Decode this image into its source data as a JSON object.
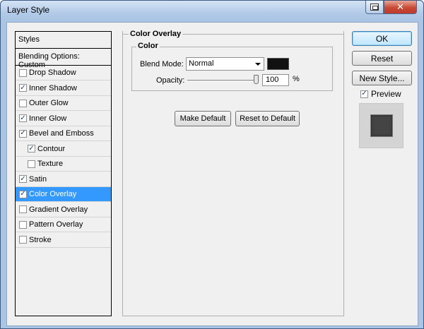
{
  "window": {
    "title": "Layer Style"
  },
  "styles_panel": {
    "header": "Styles",
    "blending_options": "Blending Options: Custom",
    "items": [
      {
        "label": "Drop Shadow",
        "checked": false,
        "indent": false,
        "selected": false
      },
      {
        "label": "Inner Shadow",
        "checked": true,
        "indent": false,
        "selected": false
      },
      {
        "label": "Outer Glow",
        "checked": false,
        "indent": false,
        "selected": false
      },
      {
        "label": "Inner Glow",
        "checked": true,
        "indent": false,
        "selected": false
      },
      {
        "label": "Bevel and Emboss",
        "checked": true,
        "indent": false,
        "selected": false
      },
      {
        "label": "Contour",
        "checked": true,
        "indent": true,
        "selected": false
      },
      {
        "label": "Texture",
        "checked": false,
        "indent": true,
        "selected": false
      },
      {
        "label": "Satin",
        "checked": true,
        "indent": false,
        "selected": false
      },
      {
        "label": "Color Overlay",
        "checked": true,
        "indent": false,
        "selected": true
      },
      {
        "label": "Gradient Overlay",
        "checked": false,
        "indent": false,
        "selected": false
      },
      {
        "label": "Pattern Overlay",
        "checked": false,
        "indent": false,
        "selected": false
      },
      {
        "label": "Stroke",
        "checked": false,
        "indent": false,
        "selected": false
      }
    ]
  },
  "overlay": {
    "title": "Color Overlay",
    "group_title": "Color",
    "blend_mode_label": "Blend Mode:",
    "blend_mode_value": "Normal",
    "swatch_color": "#111111",
    "opacity_label": "Opacity:",
    "opacity_value": "100",
    "opacity_unit": "%",
    "opacity_level": 1.0,
    "make_default_label": "Make Default",
    "reset_default_label": "Reset to Default"
  },
  "actions": {
    "ok_label": "OK",
    "reset_label": "Reset",
    "new_style_label": "New Style...",
    "preview_label": "Preview",
    "preview_checked": true
  },
  "colors": {
    "selection": "#3399ff",
    "preview_square": "#444444"
  }
}
